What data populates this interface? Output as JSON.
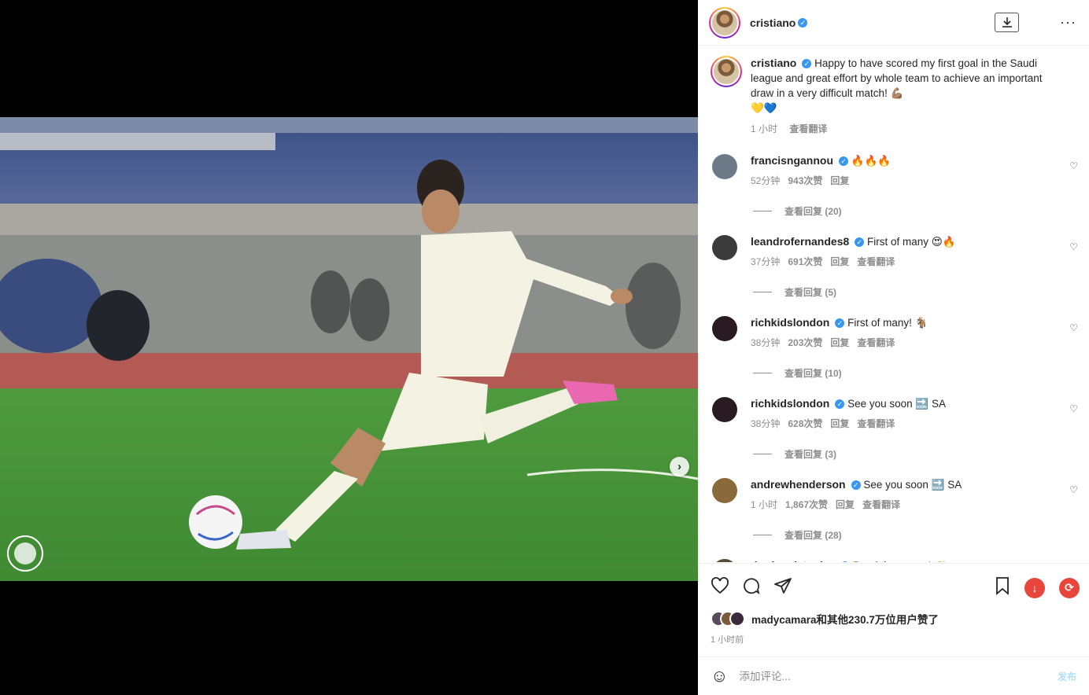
{
  "header": {
    "username": "cristiano",
    "verified_mark": "✓",
    "download_icon": "download-icon",
    "more_label": "···"
  },
  "caption": {
    "username": "cristiano",
    "text": "Happy to have scored my first goal in the Saudi league and great effort by whole team to achieve an important draw in a very difficult match! 💪🏽",
    "hearts": "💛💙",
    "time": "1 小时",
    "translate": "查看翻译"
  },
  "comments": [
    {
      "username": "francisngannou",
      "text": "🔥🔥🔥",
      "time": "52分钟",
      "likes": "943次赞",
      "reply": "回复",
      "translate": "",
      "replies": "查看回复 (20)",
      "avatar_color": "#6b7a86"
    },
    {
      "username": "leandrofernandes8",
      "text": "First of many 😍🔥",
      "time": "37分钟",
      "likes": "691次赞",
      "reply": "回复",
      "translate": "查看翻译",
      "replies": "查看回复 (5)",
      "avatar_color": "#3b3b3b"
    },
    {
      "username": "richkidslondon",
      "text": "First of many! 🐐",
      "time": "38分钟",
      "likes": "203次赞",
      "reply": "回复",
      "translate": "查看翻译",
      "replies": "查看回复 (10)",
      "avatar_color": "#2a1a22"
    },
    {
      "username": "richkidslondon",
      "text": "See you soon 🔜 SA",
      "time": "38分钟",
      "likes": "628次赞",
      "reply": "回复",
      "translate": "查看翻译",
      "replies": "查看回复 (3)",
      "avatar_color": "#2a1a22"
    },
    {
      "username": "andrewhenderson",
      "text": "See you soon 🔜 SA",
      "time": "1 小时",
      "likes": "1,867次赞",
      "reply": "回复",
      "translate": "查看翻译",
      "replies": "查看回复 (28)",
      "avatar_color": "#8a6a3a"
    },
    {
      "username": "drmiguelstanley",
      "text": "Parabéns mano! 👏",
      "time": "",
      "likes": "",
      "reply": "",
      "translate": "",
      "replies": "",
      "avatar_color": "#5a4a3a"
    }
  ],
  "likes_line": "madycamara和其他230.7万位用户赞了",
  "time_ago": "1 小时前",
  "add_comment": {
    "placeholder": "添加评论...",
    "post": "发布"
  },
  "carousel": {
    "current_index": 1,
    "count": 4,
    "next_glyph": "›"
  },
  "colors": {
    "verified": "#3897f0",
    "accent_red": "#e8463b",
    "dot_active": "#3d9ef5"
  }
}
